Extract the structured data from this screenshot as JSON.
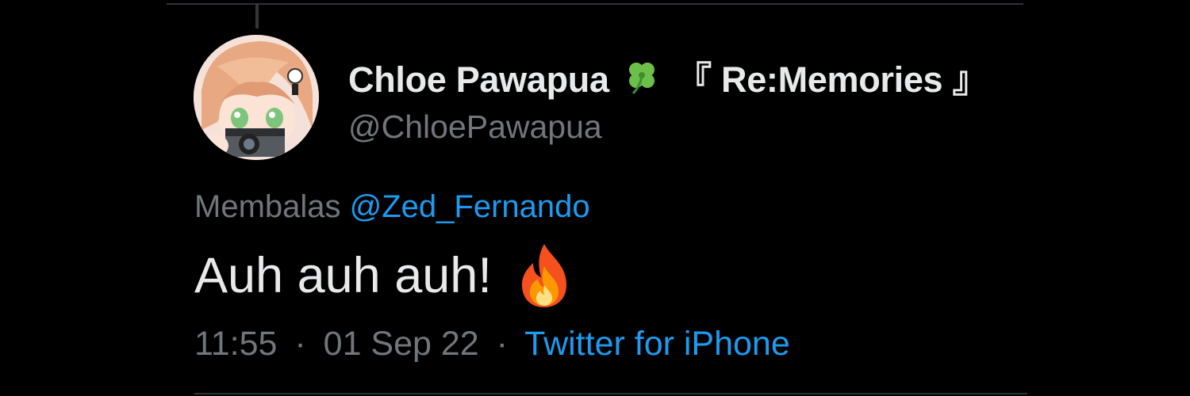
{
  "tweet": {
    "display_name": "Chloe Pawapua",
    "display_name_suffix": "『 Re:Memories 』",
    "username": "@ChloePawapua",
    "reply_prefix": "Membalas",
    "reply_to": "@Zed_Fernando",
    "text": "Auh auh auh!",
    "time": "11:55",
    "separator": "·",
    "date": "01 Sep 22",
    "source": "Twitter for iPhone"
  },
  "icons": {
    "name_emoji": "four-leaf-clover-icon",
    "text_emoji": "fire-icon",
    "avatar": "avatar-image"
  },
  "colors": {
    "background": "#000000",
    "primary_text": "#e7e9ea",
    "secondary_text": "#71767b",
    "link": "#1d9bf0",
    "divider": "#2f3336"
  }
}
